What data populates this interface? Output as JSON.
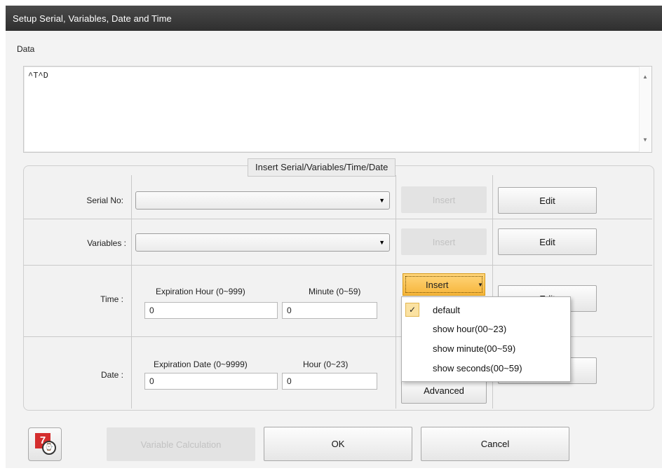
{
  "window": {
    "title": "Setup Serial, Variables, Date and Time"
  },
  "data_section": {
    "label": "Data",
    "content": "^T^D",
    "scroll_up": "▲",
    "scroll_down": "▼"
  },
  "group": {
    "title": "Insert Serial/Variables/Time/Date"
  },
  "serial": {
    "label": "Serial No:",
    "insert_label": "Insert",
    "edit_label": "Edit"
  },
  "variables": {
    "label": "Variables :",
    "insert_label": "Insert",
    "edit_label": "Edit"
  },
  "time": {
    "label": "Time :",
    "hour_label": "Expiration Hour (0~999)",
    "hour_value": "0",
    "minute_label": "Minute (0~59)",
    "minute_value": "0",
    "insert_label": "Insert",
    "edit_label": "Edit"
  },
  "date": {
    "label": "Date :",
    "date_label": "Expiration Date (0~9999)",
    "date_value": "0",
    "hour_label": "Hour (0~23)",
    "hour_value": "0",
    "advanced_label": "Advanced"
  },
  "insert_menu": {
    "items": [
      "default",
      "show hour(00~23)",
      "show minute(00~59)",
      "show seconds(00~59)"
    ],
    "checked_index": 0,
    "check_glyph": "✓",
    "caret": "▼"
  },
  "footer": {
    "variable_calc_label": "Variable Calculation",
    "ok_label": "OK",
    "cancel_label": "Cancel",
    "calendar_day": "7"
  },
  "icons": {
    "combo_arrow": "▼"
  },
  "colors": {
    "titlebar": "#3a3a3a",
    "insert_highlight": "#f6b53a",
    "calendar_red": "#d42d2d"
  }
}
